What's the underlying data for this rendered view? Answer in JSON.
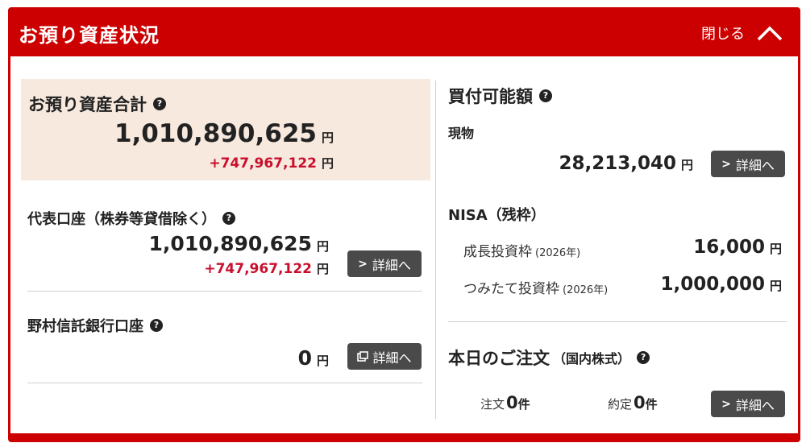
{
  "header": {
    "title": "お預り資産状況",
    "close_label": "閉じる"
  },
  "total": {
    "title": "お預り資産合計",
    "amount": "1,010,890,625",
    "diff": "+747,967,122",
    "unit": "円"
  },
  "representative": {
    "title": "代表口座（株券等貸借除く）",
    "amount": "1,010,890,625",
    "diff": "+747,967,122",
    "unit": "円",
    "detail_label": "詳細へ"
  },
  "trust_bank": {
    "title": "野村信託銀行口座",
    "amount": "0",
    "unit": "円",
    "detail_label": "詳細へ"
  },
  "buying_power": {
    "title": "買付可能額",
    "cash_label": "現物",
    "cash_amount": "28,213,040",
    "unit": "円",
    "detail_label": "詳細へ"
  },
  "nisa": {
    "title": "NISA（残枠）",
    "growth_label": "成長投資枠",
    "growth_year": "(2026年)",
    "growth_amount": "16,000",
    "tsumitate_label": "つみたて投資枠",
    "tsumitate_year": "(2026年)",
    "tsumitate_amount": "1,000,000",
    "unit": "円"
  },
  "orders": {
    "title": "本日のご注文",
    "subtitle": "（国内株式）",
    "order_label": "注文",
    "order_count": "0",
    "executed_label": "約定",
    "executed_count": "0",
    "count_unit": "件",
    "detail_label": "詳細へ"
  }
}
